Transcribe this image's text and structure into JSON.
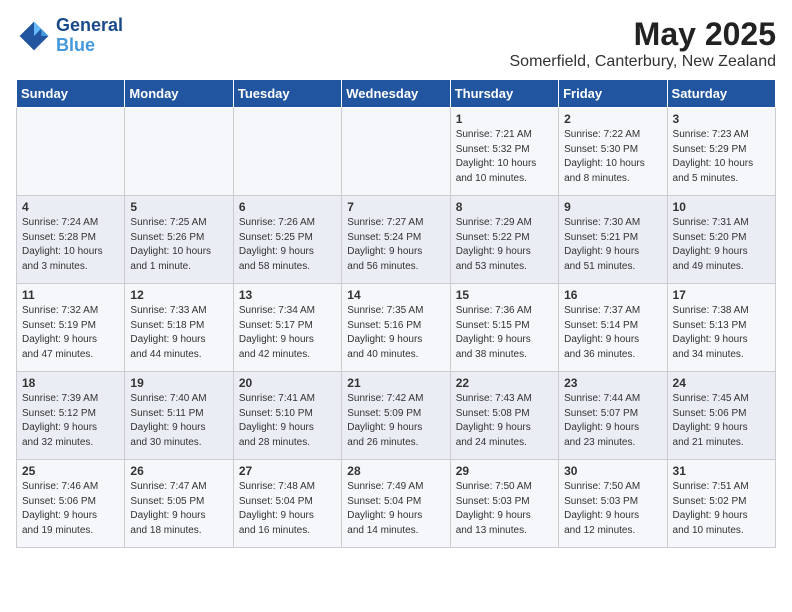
{
  "header": {
    "logo_line1": "General",
    "logo_line2": "Blue",
    "month_title": "May 2025",
    "location": "Somerfield, Canterbury, New Zealand"
  },
  "weekdays": [
    "Sunday",
    "Monday",
    "Tuesday",
    "Wednesday",
    "Thursday",
    "Friday",
    "Saturday"
  ],
  "weeks": [
    [
      {
        "day": "",
        "info": ""
      },
      {
        "day": "",
        "info": ""
      },
      {
        "day": "",
        "info": ""
      },
      {
        "day": "",
        "info": ""
      },
      {
        "day": "1",
        "info": "Sunrise: 7:21 AM\nSunset: 5:32 PM\nDaylight: 10 hours\nand 10 minutes."
      },
      {
        "day": "2",
        "info": "Sunrise: 7:22 AM\nSunset: 5:30 PM\nDaylight: 10 hours\nand 8 minutes."
      },
      {
        "day": "3",
        "info": "Sunrise: 7:23 AM\nSunset: 5:29 PM\nDaylight: 10 hours\nand 5 minutes."
      }
    ],
    [
      {
        "day": "4",
        "info": "Sunrise: 7:24 AM\nSunset: 5:28 PM\nDaylight: 10 hours\nand 3 minutes."
      },
      {
        "day": "5",
        "info": "Sunrise: 7:25 AM\nSunset: 5:26 PM\nDaylight: 10 hours\nand 1 minute."
      },
      {
        "day": "6",
        "info": "Sunrise: 7:26 AM\nSunset: 5:25 PM\nDaylight: 9 hours\nand 58 minutes."
      },
      {
        "day": "7",
        "info": "Sunrise: 7:27 AM\nSunset: 5:24 PM\nDaylight: 9 hours\nand 56 minutes."
      },
      {
        "day": "8",
        "info": "Sunrise: 7:29 AM\nSunset: 5:22 PM\nDaylight: 9 hours\nand 53 minutes."
      },
      {
        "day": "9",
        "info": "Sunrise: 7:30 AM\nSunset: 5:21 PM\nDaylight: 9 hours\nand 51 minutes."
      },
      {
        "day": "10",
        "info": "Sunrise: 7:31 AM\nSunset: 5:20 PM\nDaylight: 9 hours\nand 49 minutes."
      }
    ],
    [
      {
        "day": "11",
        "info": "Sunrise: 7:32 AM\nSunset: 5:19 PM\nDaylight: 9 hours\nand 47 minutes."
      },
      {
        "day": "12",
        "info": "Sunrise: 7:33 AM\nSunset: 5:18 PM\nDaylight: 9 hours\nand 44 minutes."
      },
      {
        "day": "13",
        "info": "Sunrise: 7:34 AM\nSunset: 5:17 PM\nDaylight: 9 hours\nand 42 minutes."
      },
      {
        "day": "14",
        "info": "Sunrise: 7:35 AM\nSunset: 5:16 PM\nDaylight: 9 hours\nand 40 minutes."
      },
      {
        "day": "15",
        "info": "Sunrise: 7:36 AM\nSunset: 5:15 PM\nDaylight: 9 hours\nand 38 minutes."
      },
      {
        "day": "16",
        "info": "Sunrise: 7:37 AM\nSunset: 5:14 PM\nDaylight: 9 hours\nand 36 minutes."
      },
      {
        "day": "17",
        "info": "Sunrise: 7:38 AM\nSunset: 5:13 PM\nDaylight: 9 hours\nand 34 minutes."
      }
    ],
    [
      {
        "day": "18",
        "info": "Sunrise: 7:39 AM\nSunset: 5:12 PM\nDaylight: 9 hours\nand 32 minutes."
      },
      {
        "day": "19",
        "info": "Sunrise: 7:40 AM\nSunset: 5:11 PM\nDaylight: 9 hours\nand 30 minutes."
      },
      {
        "day": "20",
        "info": "Sunrise: 7:41 AM\nSunset: 5:10 PM\nDaylight: 9 hours\nand 28 minutes."
      },
      {
        "day": "21",
        "info": "Sunrise: 7:42 AM\nSunset: 5:09 PM\nDaylight: 9 hours\nand 26 minutes."
      },
      {
        "day": "22",
        "info": "Sunrise: 7:43 AM\nSunset: 5:08 PM\nDaylight: 9 hours\nand 24 minutes."
      },
      {
        "day": "23",
        "info": "Sunrise: 7:44 AM\nSunset: 5:07 PM\nDaylight: 9 hours\nand 23 minutes."
      },
      {
        "day": "24",
        "info": "Sunrise: 7:45 AM\nSunset: 5:06 PM\nDaylight: 9 hours\nand 21 minutes."
      }
    ],
    [
      {
        "day": "25",
        "info": "Sunrise: 7:46 AM\nSunset: 5:06 PM\nDaylight: 9 hours\nand 19 minutes."
      },
      {
        "day": "26",
        "info": "Sunrise: 7:47 AM\nSunset: 5:05 PM\nDaylight: 9 hours\nand 18 minutes."
      },
      {
        "day": "27",
        "info": "Sunrise: 7:48 AM\nSunset: 5:04 PM\nDaylight: 9 hours\nand 16 minutes."
      },
      {
        "day": "28",
        "info": "Sunrise: 7:49 AM\nSunset: 5:04 PM\nDaylight: 9 hours\nand 14 minutes."
      },
      {
        "day": "29",
        "info": "Sunrise: 7:50 AM\nSunset: 5:03 PM\nDaylight: 9 hours\nand 13 minutes."
      },
      {
        "day": "30",
        "info": "Sunrise: 7:50 AM\nSunset: 5:03 PM\nDaylight: 9 hours\nand 12 minutes."
      },
      {
        "day": "31",
        "info": "Sunrise: 7:51 AM\nSunset: 5:02 PM\nDaylight: 9 hours\nand 10 minutes."
      }
    ]
  ]
}
